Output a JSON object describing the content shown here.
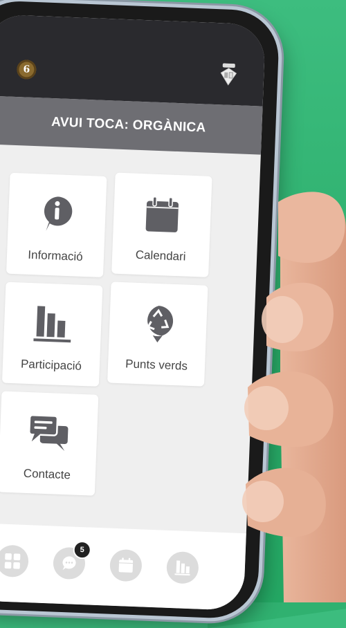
{
  "header": {
    "left_logo_text": "6",
    "left_logo_icon": "city-seal-icon",
    "right_logo_icon": "barcelona-shield-icon",
    "title": "AVUI TOCA: ORGÀNICA"
  },
  "menu": {
    "tiles": [
      {
        "label": "Informació",
        "icon": "info-icon"
      },
      {
        "label": "Calendari",
        "icon": "calendar-icon"
      },
      {
        "label": "Participació",
        "icon": "bar-chart-icon"
      },
      {
        "label": "Punts verds",
        "icon": "recycle-icon"
      },
      {
        "label": "Contacte",
        "icon": "chat-icon"
      }
    ]
  },
  "bottom_nav": {
    "items": [
      {
        "icon": "grid-icon"
      },
      {
        "icon": "chat-icon",
        "badge": "5"
      },
      {
        "icon": "calendar-icon"
      },
      {
        "icon": "bar-chart-icon"
      }
    ]
  },
  "colors": {
    "background": "#2fb16f",
    "title_bar": "#6e6e73",
    "icon": "#5f5f64",
    "header": "#2a2a2e"
  }
}
